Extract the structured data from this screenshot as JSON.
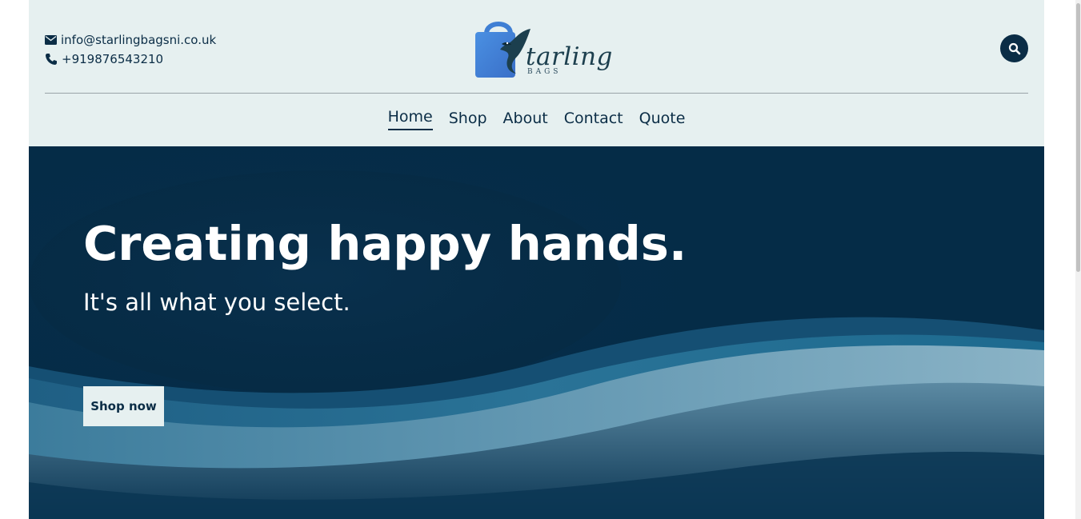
{
  "header": {
    "email": "info@starlingbagsni.co.uk",
    "phone": "+919876543210",
    "logo_word": "tarling",
    "logo_sub": "BAGS",
    "search_icon": "search-icon",
    "email_icon": "envelope-icon",
    "phone_icon": "phone-icon"
  },
  "nav": {
    "items": [
      {
        "label": "Home",
        "active": true
      },
      {
        "label": "Shop"
      },
      {
        "label": "About"
      },
      {
        "label": "Contact"
      },
      {
        "label": "Quote"
      }
    ]
  },
  "hero": {
    "title": "Creating happy hands.",
    "subtitle": "It's all what you select.",
    "cta_label": "Shop now"
  },
  "colors": {
    "header_bg": "#e6f0f0",
    "navy": "#0b2d46",
    "hero_bg": "#052c47",
    "logo_blue": "#3a86d8"
  }
}
